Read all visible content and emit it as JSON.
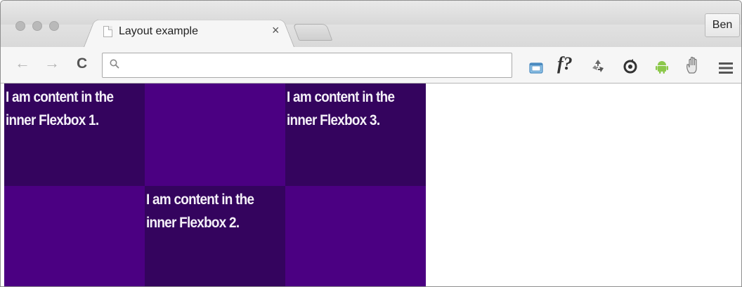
{
  "browser": {
    "tab_title": "Layout example",
    "tab_close": "×",
    "profile_name": "Ben",
    "omnibox_placeholder": "",
    "back_glyph": "←",
    "forward_glyph": "→",
    "reload_glyph": "C",
    "extensions": [
      "screen-capture-icon",
      "formula-icon",
      "recycle-icon",
      "sync-icon",
      "android-icon",
      "hand-icon"
    ],
    "formula_text": "f?",
    "menu_icon": "hamburger-menu-icon"
  },
  "colors": {
    "dark_purple": "#34045e",
    "light_purple": "#4b0082"
  },
  "flexbox": {
    "cells": [
      {
        "text": "I am content in the inner Flexbox 1.",
        "shade": "dark"
      },
      {
        "text": "",
        "shade": "light"
      },
      {
        "text": "I am content in the inner Flexbox 3.",
        "shade": "dark"
      },
      {
        "text": "",
        "shade": "light"
      },
      {
        "text": "I am content in the inner Flexbox 2.",
        "shade": "dark"
      },
      {
        "text": "",
        "shade": "light"
      }
    ]
  }
}
